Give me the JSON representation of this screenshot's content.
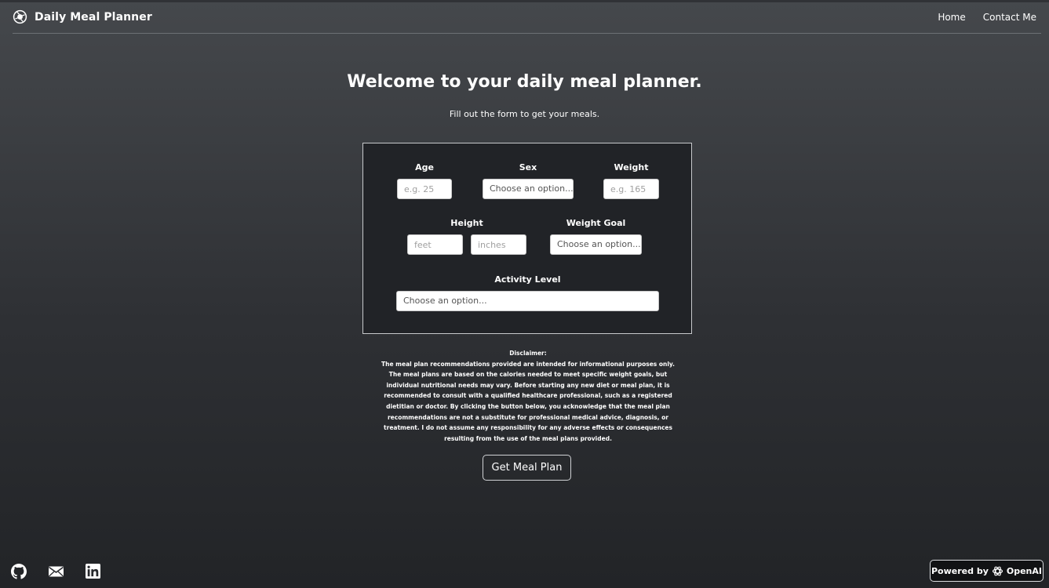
{
  "app": {
    "title": "Daily Meal Planner",
    "logo_icon": "aperture-icon"
  },
  "nav": {
    "links": [
      "Home",
      "Contact Me"
    ]
  },
  "hero": {
    "heading": "Welcome to your daily meal planner.",
    "subheading": "Fill out the form to get your meals."
  },
  "form": {
    "age": {
      "label": "Age",
      "placeholder": "e.g. 25",
      "value": ""
    },
    "sex": {
      "label": "Sex",
      "selected": "Choose an option..."
    },
    "weight": {
      "label": "Weight",
      "placeholder": "e.g. 165",
      "value": ""
    },
    "height": {
      "label": "Height",
      "feet_placeholder": "feet",
      "inches_placeholder": "inches"
    },
    "weight_goal": {
      "label": "Weight Goal",
      "selected": "Choose an option..."
    },
    "activity_level": {
      "label": "Activity Level",
      "selected": "Choose an option..."
    }
  },
  "disclaimer": {
    "title": "Disclaimer:",
    "body": "The meal plan recommendations provided are intended for informational purposes only. The meal plans are based on the calories needed to meet specific weight goals, but individual nutritional needs may vary. Before starting any new diet or meal plan, it is recommended to consult with a qualified healthcare professional, such as a registered dietitian or doctor. By clicking the button below, you acknowledge that the meal plan recommendations are not a substitute for professional medical advice, diagnosis, or treatment. I do not assume any responsibility for any adverse effects or consequences resulting from the use of the meal plans provided."
  },
  "cta": {
    "label": "Get Meal Plan"
  },
  "footer": {
    "social_icons": [
      "github-icon",
      "email-icon",
      "linkedin-icon"
    ],
    "powered_by": {
      "prefix": "Powered by",
      "brand": "OpenAI",
      "icon": "openai-icon"
    }
  },
  "colors": {
    "form_background": "#212327",
    "form_border": "#c7c9cc"
  }
}
